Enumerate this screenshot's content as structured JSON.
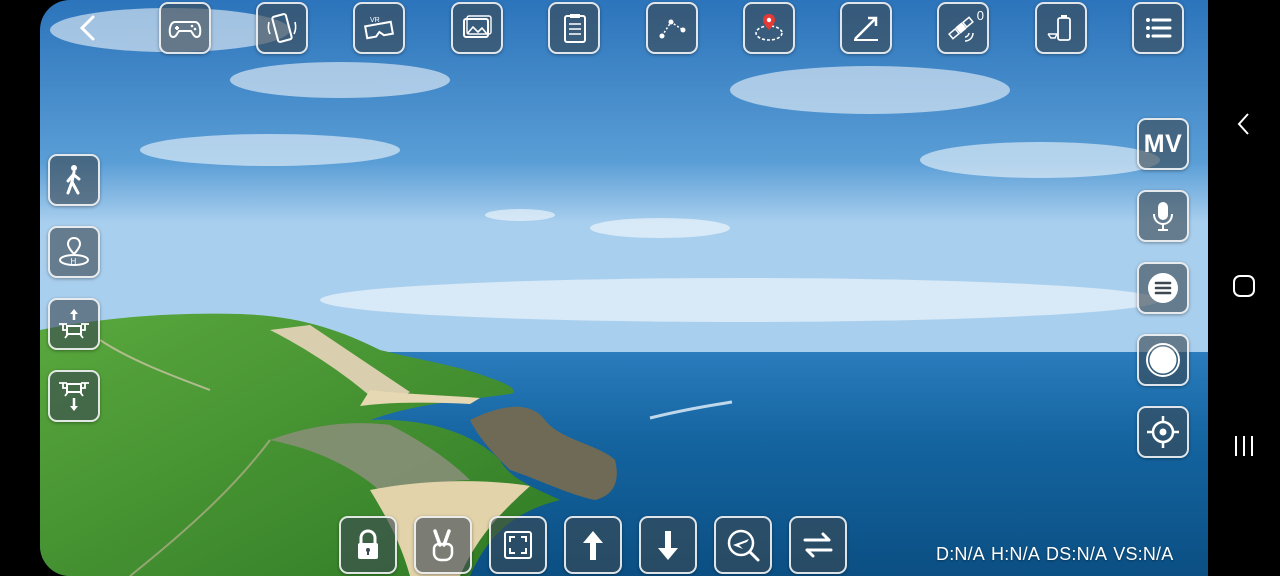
{
  "top_toolbar": [
    {
      "name": "gamepad-button",
      "icon": "gamepad-icon"
    },
    {
      "name": "phone-rotate-button",
      "icon": "phone-rotate-icon"
    },
    {
      "name": "vr-button",
      "icon": "vr-headset-icon"
    },
    {
      "name": "gallery-button",
      "icon": "gallery-icon"
    },
    {
      "name": "checklist-button",
      "icon": "checklist-icon"
    },
    {
      "name": "waypoint-route-button",
      "icon": "waypoint-route-icon"
    },
    {
      "name": "orbit-button",
      "icon": "orbit-icon"
    },
    {
      "name": "gesture-flight-button",
      "icon": "draw-line-icon"
    },
    {
      "name": "satellite-button",
      "icon": "satellite-icon",
      "count": "0"
    },
    {
      "name": "drone-battery-button",
      "icon": "drone-battery-icon"
    },
    {
      "name": "menu-button",
      "icon": "menu-list-icon"
    }
  ],
  "right_panel": {
    "mv_label": "MV",
    "buttons": [
      "mv-button",
      "voice-button",
      "settings-toggle-button",
      "shutter-button",
      "target-button"
    ]
  },
  "left_panel": [
    "follow-me-button",
    "return-home-button",
    "takeoff-button",
    "landing-button"
  ],
  "bottom_bar": [
    "lock-button",
    "gesture-button",
    "fullscreen-button",
    "ascend-button",
    "descend-button",
    "flight-mode-button",
    "swap-button"
  ],
  "telemetry": {
    "distance": "D:N/A",
    "height": "H:N/A",
    "horizontal_speed": "DS:N/A",
    "vertical_speed": "VS:N/A"
  },
  "colors": {
    "button_bg": "#3c4852",
    "button_border": "#ffffff",
    "sky_top": "#2f79bf",
    "sea": "#0f5a8d",
    "grass": "#3f8c2e"
  }
}
